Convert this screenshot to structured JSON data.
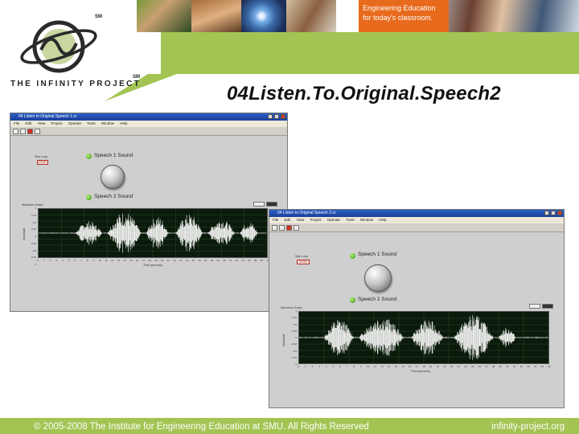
{
  "header": {
    "tagline_line1": "Engineering Education",
    "tagline_line2": "for today's classroom.",
    "logo_text": "THE INFINITY PROJECT",
    "sm_mark": "SM",
    "brand_green": "#a3c453",
    "tagline_orange": "#e86a1c"
  },
  "slide": {
    "title": "04Listen.To.Original.Speech2"
  },
  "window_back": {
    "title": "04 Listen to Original Speech 1.vi",
    "menu": [
      "File",
      "Edit",
      "View",
      "Project",
      "Operate",
      "Tools",
      "Window",
      "Help"
    ],
    "stop_label": "Stop Loop",
    "stop_button": "STOP",
    "speech1_label": "Speech 1 Sound",
    "speech2_label": "Speech 2 Sound",
    "graph_label": "Waveform Graph",
    "y_axis_label": "Amplitude",
    "x_axis_label": "Time (seconds)",
    "y_ticks": [
      "1",
      "0.75",
      "0.5",
      "0.25",
      "0",
      "-0.25",
      "-0.5",
      "-0.75",
      "-1"
    ],
    "x_ticks": [
      "0",
      "1",
      "2",
      "3",
      "4",
      "5",
      "6",
      "7",
      "8",
      "9",
      "10",
      "11",
      "12",
      "13",
      "14",
      "15",
      "16",
      "17",
      "18",
      "19",
      "20",
      "21",
      "22",
      "23",
      "24",
      "25",
      "26",
      "27",
      "28",
      "29",
      "30",
      "31",
      "32",
      "33",
      "34",
      "35",
      "36",
      "37"
    ]
  },
  "window_front": {
    "title": "04 Listen to Original Speech 2.vi",
    "menu": [
      "File",
      "Edit",
      "View",
      "Project",
      "Operate",
      "Tools",
      "Window",
      "Help"
    ],
    "stop_label": "Stop Loop",
    "stop_button": "STOP",
    "speech1_label": "Speech 1 Sound",
    "speech2_label": "Speech 2 Sound",
    "graph_label": "Waveform Graph",
    "y_axis_label": "Amplitude",
    "x_axis_label": "Time (seconds)",
    "y_ticks": [
      "1",
      "0.75",
      "0.5",
      "0.25",
      "0",
      "-0.25",
      "-0.5",
      "-0.75",
      "-1"
    ],
    "x_ticks": [
      "0",
      "1",
      "2",
      "3",
      "4",
      "5",
      "6",
      "7",
      "8",
      "9",
      "10",
      "11",
      "12",
      "13",
      "14",
      "15",
      "16",
      "17",
      "18",
      "19",
      "20",
      "21",
      "22",
      "23",
      "24",
      "25",
      "26",
      "27",
      "28",
      "29",
      "30",
      "31",
      "32",
      "33",
      "34",
      "35",
      "36"
    ]
  },
  "footer": {
    "copyright": "© 2005-2008 The Institute for Engineering Education at SMU.  All Rights Reserved",
    "site": "infinity-project.org"
  }
}
